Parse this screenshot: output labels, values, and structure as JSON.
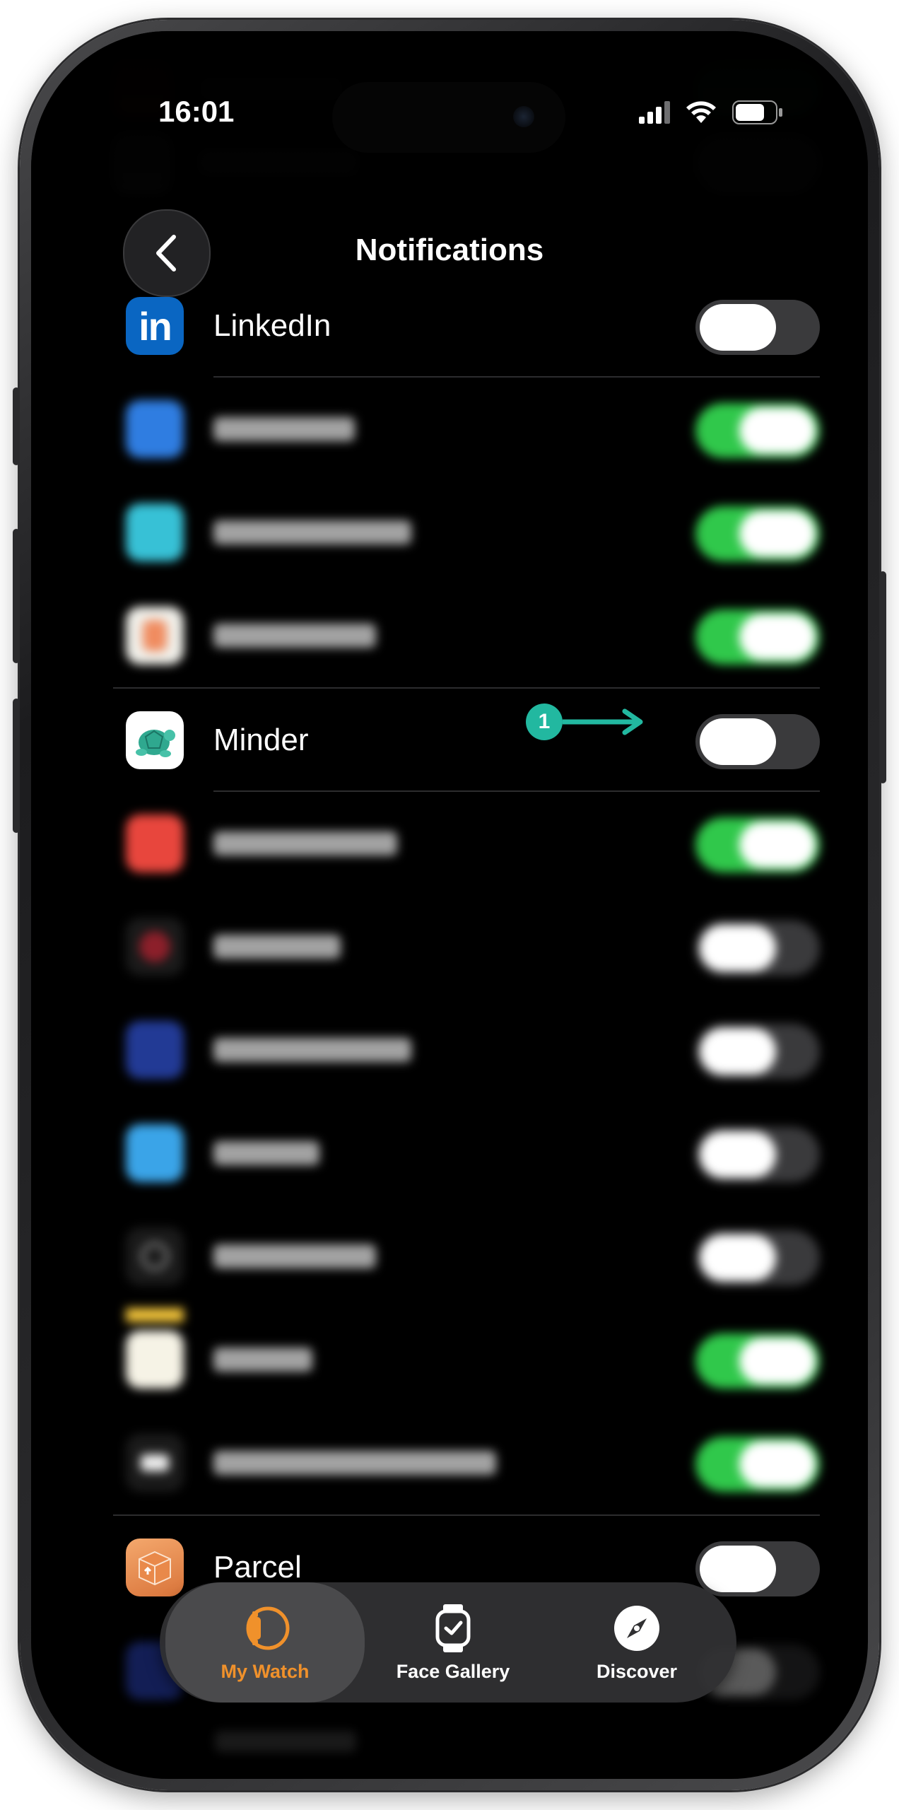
{
  "status_bar": {
    "time": "16:01"
  },
  "nav": {
    "title": "Notifications",
    "back_label": "Back"
  },
  "apps": [
    {
      "name": "LinkedIn",
      "icon": "linkedin-icon",
      "enabled": false,
      "blurred": false,
      "color": "#0a66c2"
    },
    {
      "name": "",
      "icon": "app-icon",
      "enabled": true,
      "blurred": true,
      "color": "#2f7de1"
    },
    {
      "name": "",
      "icon": "app-icon",
      "enabled": true,
      "blurred": true,
      "color": "#37c1d6"
    },
    {
      "name": "",
      "icon": "app-icon",
      "enabled": true,
      "blurred": true,
      "color": "#f0efe9"
    },
    {
      "name": "Minder",
      "icon": "turtle-icon",
      "enabled": false,
      "blurred": false,
      "color": "#ffffff"
    },
    {
      "name": "",
      "icon": "app-icon",
      "enabled": true,
      "blurred": true,
      "color": "#e8463d"
    },
    {
      "name": "",
      "icon": "app-icon",
      "enabled": false,
      "blurred": true,
      "color": "#6b1d1d"
    },
    {
      "name": "",
      "icon": "app-icon",
      "enabled": false,
      "blurred": true,
      "color": "#223a95"
    },
    {
      "name": "",
      "icon": "app-icon",
      "enabled": false,
      "blurred": true,
      "color": "#3aa4e8"
    },
    {
      "name": "",
      "icon": "app-icon",
      "enabled": false,
      "blurred": true,
      "color": "#1a1a1a"
    },
    {
      "name": "",
      "icon": "app-icon",
      "enabled": true,
      "blurred": true,
      "color": "#f6f3e6"
    },
    {
      "name": "",
      "icon": "app-icon",
      "enabled": true,
      "blurred": true,
      "color": "#1a1a1a"
    },
    {
      "name": "Parcel",
      "icon": "parcel-box-icon",
      "enabled": false,
      "blurred": false,
      "color": "#e58b4e"
    }
  ],
  "annotation": {
    "number": "1"
  },
  "tabbar": {
    "tabs": [
      {
        "label": "My Watch",
        "icon": "watch-icon",
        "active": true
      },
      {
        "label": "Face Gallery",
        "icon": "watch-face-icon",
        "active": false
      },
      {
        "label": "Discover",
        "icon": "compass-icon",
        "active": false
      }
    ]
  },
  "colors": {
    "toggle_on": "#30c84b",
    "accent": "#f0912b",
    "annotation": "#22b8a0"
  }
}
